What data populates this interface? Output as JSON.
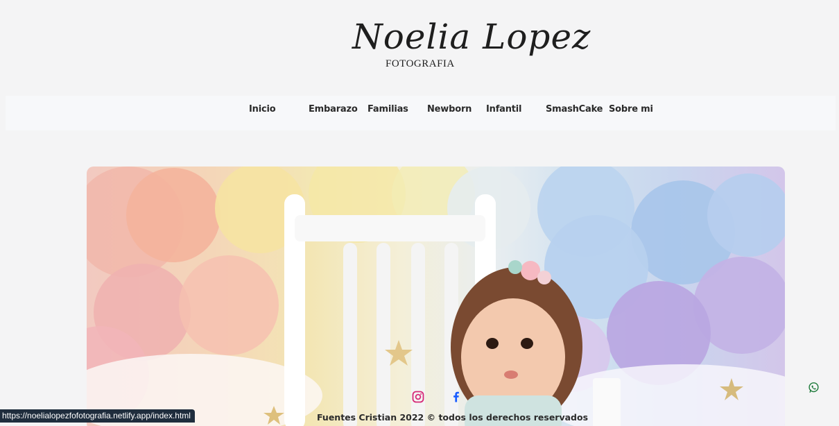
{
  "logo": {
    "script_text": "Noelia Lopez",
    "subtitle": "FOTOGRAFIA"
  },
  "nav": {
    "items": [
      {
        "label": "Inicio"
      },
      {
        "label": "Embarazo"
      },
      {
        "label": "Familias"
      },
      {
        "label": "Newborn"
      },
      {
        "label": "Infantil"
      },
      {
        "label": "SmashCake"
      },
      {
        "label": "Sobre mi"
      }
    ]
  },
  "hero": {
    "image_subject": "baby-with-pastel-balloons-photo"
  },
  "social": {
    "instagram_icon": "instagram-icon",
    "facebook_icon": "facebook-icon",
    "instagram_color": "#d62976",
    "facebook_color": "#1a5dff"
  },
  "footer": {
    "copyright": "Fuentes Cristian 2022 © todos los derechos reservados"
  },
  "status_bar": {
    "url": "https://noelialopezfofotografia.netlify.app/index.html"
  },
  "floating": {
    "whatsapp_icon": "whatsapp-icon",
    "whatsapp_color": "#1d7a3a"
  }
}
